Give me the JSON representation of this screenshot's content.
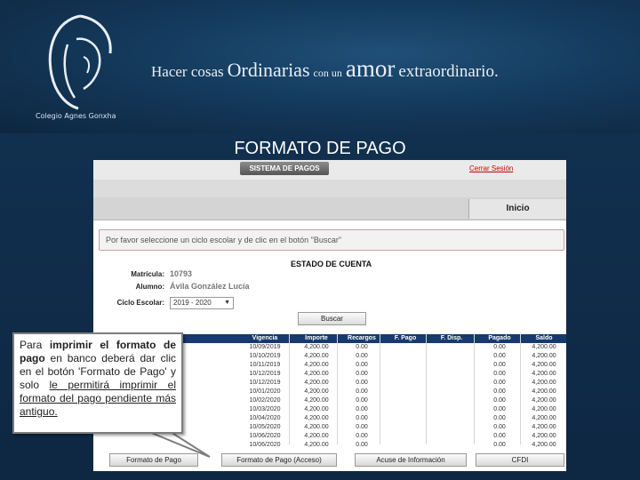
{
  "header": {
    "school_name": "Colegio Agnes Gonxha",
    "slogan_1": "Hacer cosas",
    "slogan_2": "Ordinarias",
    "slogan_3": "con un",
    "slogan_4": "amor",
    "slogan_5": "extraordinario."
  },
  "slide_title": "FORMATO DE PAGO",
  "app": {
    "system_button": "SISTEMA DE PAGOS",
    "logout": "Cerrar Sesión",
    "nav_home": "Inicio",
    "alert_text": "Por favor seleccione un ciclo escolar y de clic en el botón \"Buscar\"",
    "section_title": "ESTADO DE CUENTA",
    "matricula_label": "Matrícula:",
    "matricula_value": "10793",
    "alumno_label": "Alumno:",
    "alumno_value": "Ávila González Lucía",
    "ciclo_label": "Ciclo Escolar:",
    "ciclo_value": "2019 - 2020",
    "search_button": "Buscar",
    "table": {
      "columns": [
        "Vigencia",
        "Importe",
        "Recargos",
        "F. Pago",
        "F. Disp.",
        "Pagado",
        "Saldo"
      ],
      "rows": [
        [
          "10/09/2019",
          "4,200.00",
          "0.00",
          "",
          "",
          "0.00",
          "4,200.00"
        ],
        [
          "10/10/2019",
          "4,200.00",
          "0.00",
          "",
          "",
          "0.00",
          "4,200.00"
        ],
        [
          "10/11/2019",
          "4,200.00",
          "0.00",
          "",
          "",
          "0.00",
          "4,200.00"
        ],
        [
          "10/12/2019",
          "4,200.00",
          "0.00",
          "",
          "",
          "0.00",
          "4,200.00"
        ],
        [
          "10/12/2019",
          "4,200.00",
          "0.00",
          "",
          "",
          "0.00",
          "4,200.00"
        ],
        [
          "10/01/2020",
          "4,200.00",
          "0.00",
          "",
          "",
          "0.00",
          "4,200.00"
        ],
        [
          "10/02/2020",
          "4,200.00",
          "0.00",
          "",
          "",
          "0.00",
          "4,200.00"
        ],
        [
          "10/03/2020",
          "4,200.00",
          "0.00",
          "",
          "",
          "0.00",
          "4,200.00"
        ],
        [
          "10/04/2020",
          "4,200.00",
          "0.00",
          "",
          "",
          "0.00",
          "4,200.00"
        ],
        [
          "10/05/2020",
          "4,200.00",
          "0.00",
          "",
          "",
          "0.00",
          "4,200.00"
        ],
        [
          "10/06/2020",
          "4,200.00",
          "0.00",
          "",
          "",
          "0.00",
          "4,200.00"
        ],
        [
          "10/06/2020",
          "4,200.00",
          "0.00",
          "",
          "",
          "0.00",
          "4,200.00"
        ]
      ]
    },
    "buttons": {
      "formato_pago": "Formato de Pago",
      "formato_pago_acceso": "Formato de Pago (Acceso)",
      "acuse": "Acuse de Información",
      "cfdi": "CFDI"
    }
  },
  "callout": {
    "t1": "Para ",
    "t2": "imprimir el formato de pago",
    "t3": " en banco deberá dar clic en el botón 'Formato de Pago' y solo ",
    "t4": "le permitirá imprimir el formato del pago pendiente más antiguo."
  },
  "colors": {
    "table_header": "#173a6e",
    "background": "#0f2a44",
    "logout": "#cc0000"
  }
}
